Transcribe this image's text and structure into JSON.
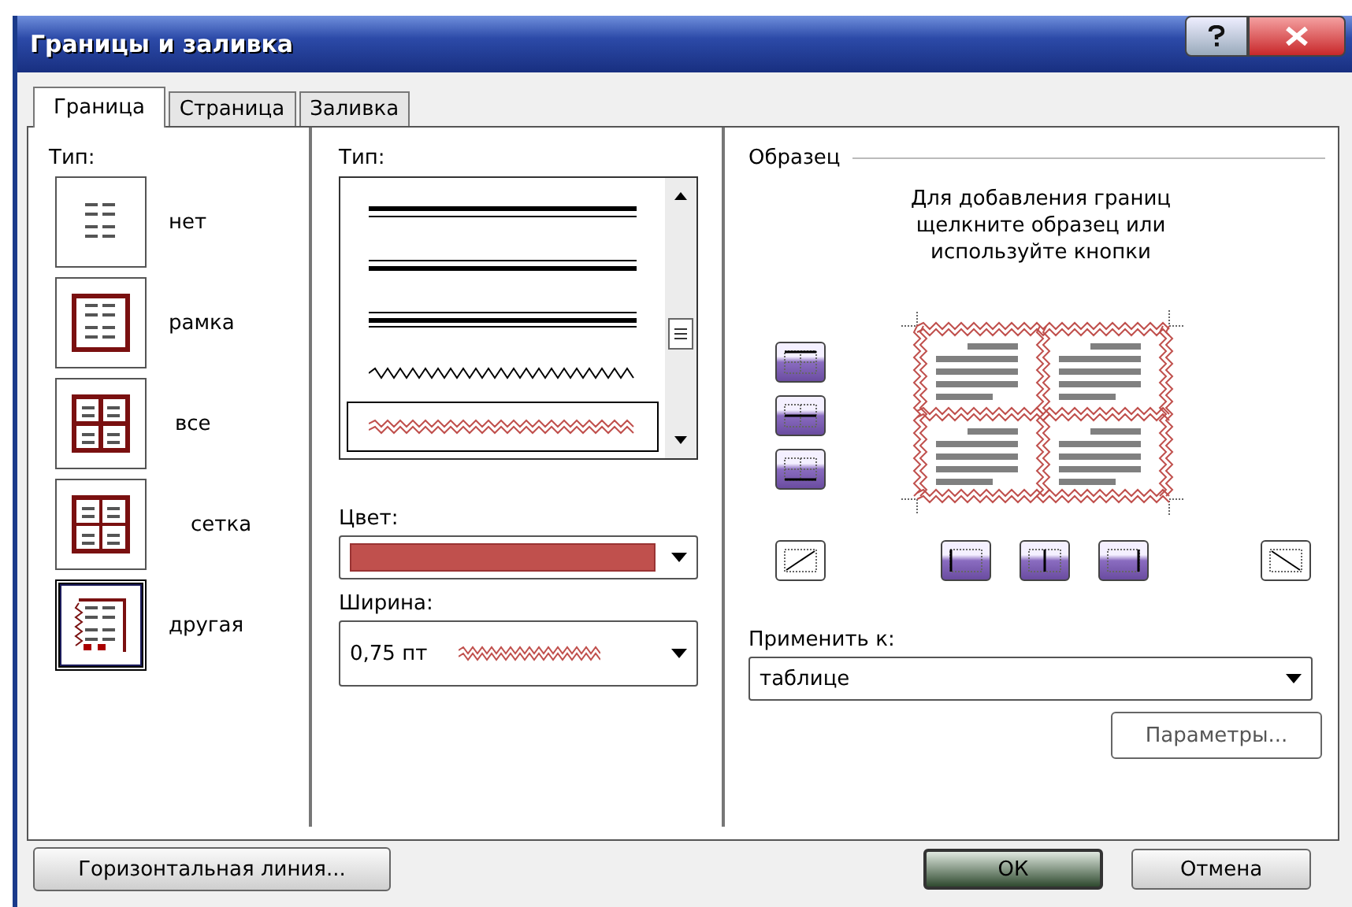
{
  "window": {
    "title": "Границы и заливка"
  },
  "tabs": [
    {
      "label": "Граница",
      "selected": true
    },
    {
      "label": "Страница",
      "selected": false
    },
    {
      "label": "Заливка",
      "selected": false
    }
  ],
  "setting": {
    "label": "Тип:",
    "items": [
      {
        "kind": "none",
        "label": "нет",
        "selected": false
      },
      {
        "kind": "box",
        "label": "рамка",
        "selected": false
      },
      {
        "kind": "all",
        "label": "все",
        "selected": false
      },
      {
        "kind": "grid",
        "label": "сетка",
        "selected": false
      },
      {
        "kind": "custom",
        "label": "другая",
        "selected": true
      }
    ]
  },
  "style": {
    "label": "Тип:",
    "items": [
      {
        "kind": "thick-thin",
        "selected": false
      },
      {
        "kind": "thin-thick",
        "selected": false
      },
      {
        "kind": "thin-thick-thin",
        "selected": false
      },
      {
        "kind": "wave",
        "selected": false
      },
      {
        "kind": "double-wave",
        "selected": true
      }
    ]
  },
  "color": {
    "label": "Цвет:",
    "color": "#c0504d"
  },
  "width": {
    "label": "Ширина:",
    "value": "0,75 пт"
  },
  "preview": {
    "label": "Образец",
    "hint": "Для добавления границ щелкните образец или используйте кнопки",
    "side_buttons": [
      {
        "kind": "top",
        "pressed": true
      },
      {
        "kind": "middle",
        "pressed": true
      },
      {
        "kind": "bottom",
        "pressed": true
      }
    ],
    "bottom_buttons": [
      {
        "kind": "diag-up",
        "pressed": false
      },
      {
        "kind": "left",
        "pressed": true
      },
      {
        "kind": "center",
        "pressed": true
      },
      {
        "kind": "right",
        "pressed": true
      },
      {
        "kind": "diag-down",
        "pressed": false
      }
    ]
  },
  "apply_to": {
    "label": "Применить к:",
    "value": "таблице"
  },
  "options_button": {
    "label": "Параметры...",
    "disabled": true
  },
  "buttons": [
    {
      "label": "Горизонтальная линия..."
    },
    {
      "label": "ОК",
      "default": true
    },
    {
      "label": "Отмена",
      "default": false
    }
  ]
}
